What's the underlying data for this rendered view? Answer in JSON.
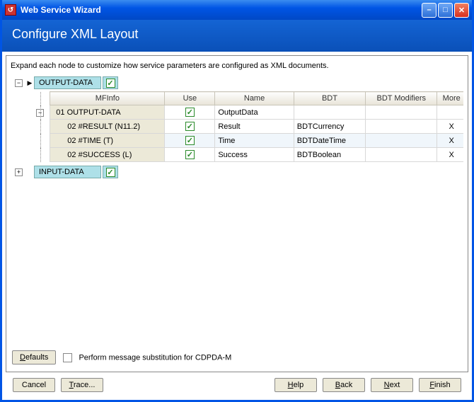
{
  "window": {
    "title": "Web Service Wizard"
  },
  "header": {
    "title": "Configure XML Layout"
  },
  "instruction": "Expand each node to customize how service parameters are configured as XML documents.",
  "nodes": {
    "output": {
      "label": "OUTPUT-DATA"
    },
    "input": {
      "label": "INPUT-DATA"
    }
  },
  "grid": {
    "headers": {
      "mfinfo": "MFInfo",
      "use": "Use",
      "name": "Name",
      "bdt": "BDT",
      "bdtmod": "BDT Modifiers",
      "more": "More"
    },
    "rows": [
      {
        "level": 1,
        "mf": "01 OUTPUT-DATA",
        "name": "OutputData",
        "bdt": "",
        "mod": "",
        "more": ""
      },
      {
        "level": 2,
        "mf": "02 #RESULT (N11.2)",
        "name": "Result",
        "bdt": "BDTCurrency",
        "mod": "",
        "more": "X"
      },
      {
        "level": 2,
        "mf": "02 #TIME (T)",
        "name": "Time",
        "bdt": "BDTDateTime",
        "mod": "",
        "more": "X",
        "alt": true
      },
      {
        "level": 2,
        "mf": "02 #SUCCESS (L)",
        "name": "Success",
        "bdt": "BDTBoolean",
        "mod": "",
        "more": "X"
      }
    ]
  },
  "bottom": {
    "defaults": "Defaults",
    "subst": "Perform message substitution for CDPDA-M"
  },
  "footer": {
    "cancel": "Cancel",
    "trace": "Trace...",
    "help": "Help",
    "back": "Back",
    "next": "Next",
    "finish": "Finish"
  }
}
